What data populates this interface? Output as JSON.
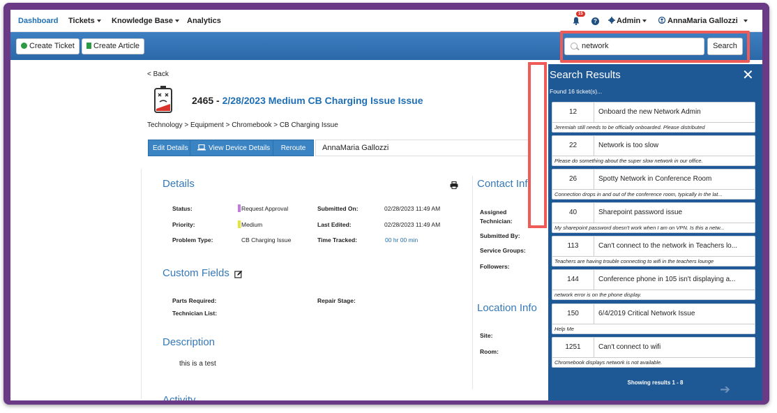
{
  "nav": {
    "dashboard": "Dashboard",
    "tickets": "Tickets",
    "knowledge_base": "Knowledge Base",
    "analytics": "Analytics",
    "notifications_count": "15",
    "help": "?",
    "admin": "Admin",
    "user": "AnnaMaria Gallozzi"
  },
  "toolbar": {
    "create_ticket": "Create Ticket",
    "create_article": "Create Article"
  },
  "search": {
    "value": "network",
    "button": "Search"
  },
  "ticket": {
    "back": "< Back",
    "number": "2465 - ",
    "title": "2/28/2023 Medium CB Charging Issue Issue",
    "breadcrumb": "Technology > Equipment > Chromebook > CB Charging Issue",
    "buttons": {
      "edit": "Edit Details",
      "view_device": "View Device Details",
      "reroute": "Reroute"
    },
    "assignee": "AnnaMaria Gallozzi"
  },
  "details": {
    "heading": "Details",
    "status_label": "Status:",
    "status_value": "Request Approval",
    "priority_label": "Priority:",
    "priority_value": "Medium",
    "problem_type_label": "Problem Type:",
    "problem_type_value": "CB Charging Issue",
    "submitted_on_label": "Submitted On:",
    "submitted_on_value": "02/28/2023 11:49 AM",
    "last_edited_label": "Last Edited:",
    "last_edited_value": "02/28/2023 11:49 AM",
    "time_tracked_label": "Time Tracked:",
    "time_tracked_value": "00 hr 00 min",
    "status_color": "#c27be0",
    "priority_color": "#e6e43a"
  },
  "custom_fields": {
    "heading": "Custom Fields",
    "parts_label": "Parts Required:",
    "repair_stage_label": "Repair Stage:",
    "tech_list_label": "Technician List:"
  },
  "description": {
    "heading": "Description",
    "text": "this is a test",
    "activity_heading": "Activity"
  },
  "contact": {
    "heading": "Contact Info",
    "assigned_label": "Assigned Technician:",
    "submitted_by_label": "Submitted By:",
    "service_groups_label": "Service Groups:",
    "followers_label": "Followers:"
  },
  "location": {
    "heading": "Location Info",
    "site_label": "Site:",
    "room_label": "Room:"
  },
  "results": {
    "title": "Search Results",
    "close": "✕",
    "found": "Found 16 ticket(s)...",
    "items": [
      {
        "num": "12",
        "subject": "Onboard the new Network Admin",
        "desc": "Jeremiah still needs to be officially onboarded. Please distributed"
      },
      {
        "num": "22",
        "subject": "Network is too slow",
        "desc": "Please do something about the super slow network in our office."
      },
      {
        "num": "26",
        "subject": "Spotty Network in Conference Room",
        "desc": "Connection drops in and out of the conference room, typically in the lat..."
      },
      {
        "num": "40",
        "subject": "Sharepoint password issue",
        "desc": "My sharepoint password doesn't work when I am on VPN. Is this a netw..."
      },
      {
        "num": "113",
        "subject": "Can't connect to the network in Teachers lo...",
        "desc": "Teachers are having trouble connecting to wifi in the teachers lounge"
      },
      {
        "num": "144",
        "subject": "Conference phone in 105 isn't displaying a...",
        "desc": "network error is on the phone display."
      },
      {
        "num": "150",
        "subject": "6/4/2019 Critical Network Issue",
        "desc": "Help Me"
      },
      {
        "num": "1251",
        "subject": "Can't connect to wifi",
        "desc": "Chromebook displays network is not available."
      }
    ],
    "showing": "Showing results 1 - 8",
    "next": "➔"
  },
  "colors": {
    "brand_blue": "#1f6fb5",
    "toolbar_blue": "#2b68a8",
    "panel_blue": "#1e5895",
    "highlight_red": "#ef5b57",
    "frame_purple": "#6a3a86"
  }
}
